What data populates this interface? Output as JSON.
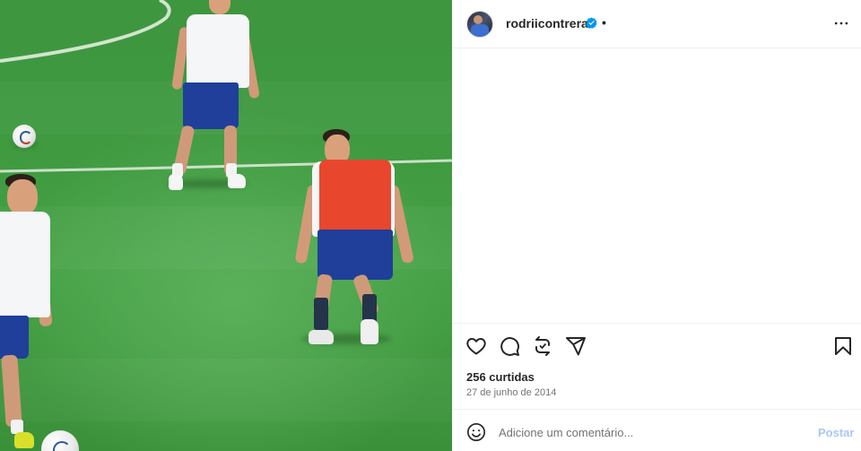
{
  "post": {
    "username": "rodriicontreras",
    "separator": "•",
    "likes_text": "256 curtidas",
    "date_text": "27 de junho de 2014"
  },
  "composer": {
    "placeholder": "Adicione um comentário...",
    "post_label": "Postar"
  },
  "icons": {
    "verified": "verified-badge-icon",
    "more": "more-options-icon",
    "like": "heart-icon",
    "comment": "comment-bubble-icon",
    "repost": "repost-icon",
    "share": "share-send-icon",
    "save": "bookmark-icon",
    "emoji": "emoji-smiley-icon"
  },
  "colors": {
    "verified_blue": "#0095f6",
    "post_button_disabled": "#a8c7f4",
    "secondary_text": "#737373"
  }
}
